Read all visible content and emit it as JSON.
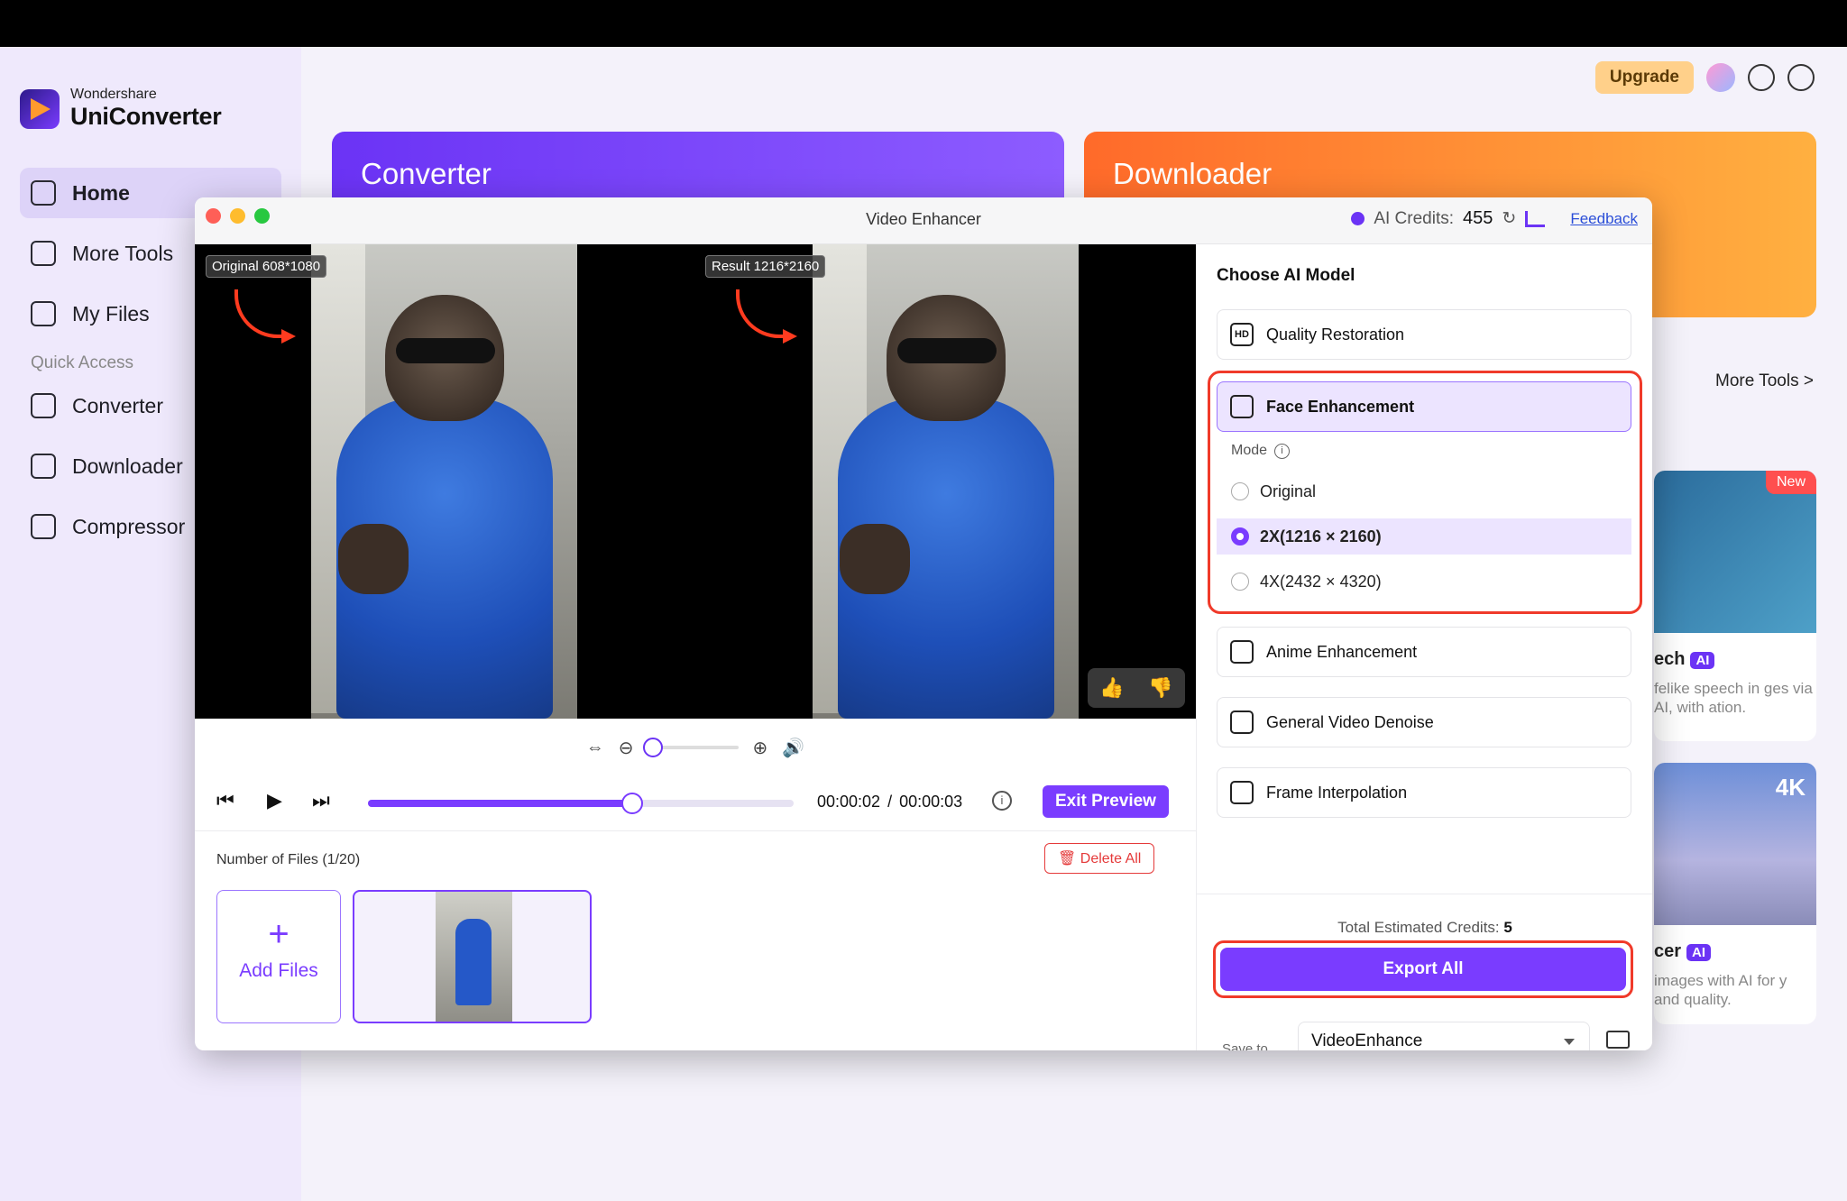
{
  "app": {
    "brand_small": "Wondershare",
    "brand_name": "UniConverter",
    "upgrade_label": "Upgrade"
  },
  "sidebar": {
    "items": [
      {
        "label": "Home",
        "icon": "home-icon",
        "active": true
      },
      {
        "label": "More Tools",
        "icon": "toolbox-icon"
      },
      {
        "label": "My Files",
        "icon": "file-icon"
      }
    ],
    "quick_access_label": "Quick Access",
    "quick_items": [
      {
        "label": "Converter",
        "icon": "converter-icon"
      },
      {
        "label": "Downloader",
        "icon": "downloader-icon"
      },
      {
        "label": "Compressor",
        "icon": "compressor-icon"
      }
    ]
  },
  "cards": {
    "converter_title": "Converter",
    "downloader_title": "Downloader",
    "more_tools_link": "More Tools >",
    "new_badge": "New",
    "card1_title_partial": "ech",
    "card1_desc_partial": "felike speech in ges via AI, with ation.",
    "card2_tag": "4K",
    "card2_title_partial": "cer",
    "card2_desc_partial": "images with AI for y and quality.",
    "ai_badge": "AI"
  },
  "dialog": {
    "title": "Video Enhancer",
    "credits_label": "AI Credits:",
    "credits_value": "455",
    "feedback_label": "Feedback",
    "original_label": "Original 608*1080",
    "result_label": "Result 1216*2160",
    "playback": {
      "current_time": "00:00:02",
      "separator": "/",
      "total_time": "00:00:03",
      "progress": 0.62,
      "exit_preview_label": "Exit Preview"
    },
    "files": {
      "count_label": "Number of Files (1/20)",
      "delete_all_label": "Delete All",
      "add_files_label": "Add Files",
      "add_plus": "+"
    }
  },
  "panel": {
    "title": "Choose AI Model",
    "models": [
      {
        "label": "Quality Restoration",
        "icon": "hd-icon",
        "icon_text": "HD"
      },
      {
        "label": "Face Enhancement",
        "icon": "face-scan-icon",
        "selected": true
      },
      {
        "label": "Anime Enhancement",
        "icon": "anime-icon"
      },
      {
        "label": "General Video Denoise",
        "icon": "denoise-icon"
      },
      {
        "label": "Frame Interpolation",
        "icon": "frame-icon"
      }
    ],
    "mode_label": "Mode",
    "modes": [
      {
        "label": "Original",
        "selected": false
      },
      {
        "label": "2X(1216 × 2160)",
        "selected": true
      },
      {
        "label": "4X(2432 × 4320)",
        "selected": false
      }
    ],
    "estimated_credits_label": "Total Estimated Credits:",
    "estimated_credits_value": "5",
    "export_label": "Export All",
    "save_to_label": "Save to",
    "save_to_value": "VideoEnhance"
  },
  "colors": {
    "accent": "#7a3cff",
    "highlight": "#f03a2a"
  }
}
